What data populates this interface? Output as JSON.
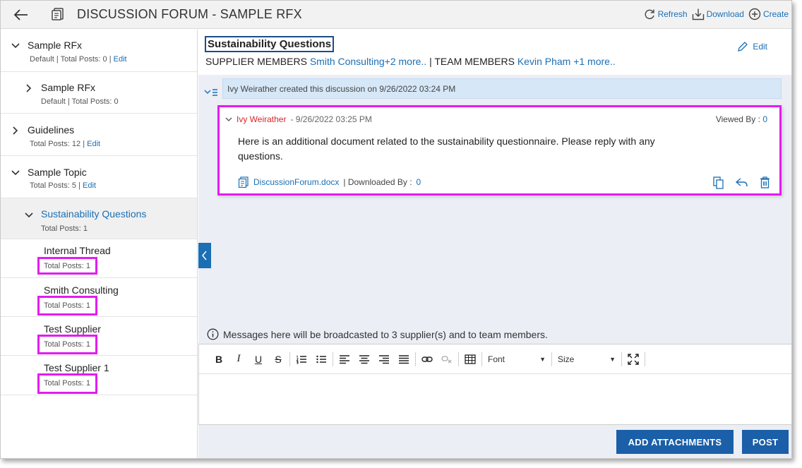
{
  "header": {
    "title": "DISCUSSION FORUM - SAMPLE RFX",
    "actions": {
      "refresh": "Refresh",
      "download": "Download",
      "create": "Create"
    }
  },
  "sidebar": {
    "items": [
      {
        "title": "Sample RFx",
        "meta": "Default | Total Posts: 0 |",
        "edit": "Edit"
      },
      {
        "title": "Sample RFx",
        "meta": "Default | Total Posts: 0"
      },
      {
        "title": "Guidelines",
        "meta": "Total Posts: 12 |",
        "edit": "Edit"
      },
      {
        "title": "Sample Topic",
        "meta": "Total Posts: 5 |",
        "edit": "Edit"
      },
      {
        "title": "Sustainability Questions",
        "meta": "Total Posts: 1"
      },
      {
        "title": "Internal Thread",
        "meta": "Total Posts: 1"
      },
      {
        "title": "Smith Consulting",
        "meta": "Total Posts: 1"
      },
      {
        "title": "Test Supplier",
        "meta": "Total Posts: 1"
      },
      {
        "title": "Test Supplier 1",
        "meta": "Total Posts: 1"
      }
    ]
  },
  "main": {
    "discussion_title": "Sustainability Questions",
    "edit": "Edit",
    "supplier_members_label": "SUPPLIER MEMBERS",
    "supplier_members_link": "Smith Consulting+2 more..",
    "separator": "|",
    "team_members_label": "TEAM MEMBERS",
    "team_members_link": "Kevin Pham +1 more..",
    "created_text": "Ivy Weirather created this discussion on 9/26/2022 03:24 PM",
    "post": {
      "author": "Ivy Weirather",
      "timestamp": "- 9/26/2022 03:25 PM",
      "viewed_label": "Viewed By :",
      "viewed_count": "0",
      "body": "Here is an additional document related to the sustainability questionnaire. Please reply with any questions.",
      "attachment": "DiscussionForum.docx",
      "downloaded_label": "| Downloaded By :",
      "downloaded_count": "0"
    },
    "broadcast": "Messages here will be broadcasted to 3 supplier(s) and to team members.",
    "toolbar": {
      "bold": "B",
      "italic": "I",
      "underline": "U",
      "strike": "S",
      "font": "Font",
      "size": "Size"
    },
    "buttons": {
      "add_attachments": "ADD ATTACHMENTS",
      "post": "POST"
    }
  },
  "colors": {
    "accent": "#1a6fb5",
    "highlight": "#e21cf0",
    "author": "#d7262a",
    "primary_button": "#1a5fa8"
  }
}
